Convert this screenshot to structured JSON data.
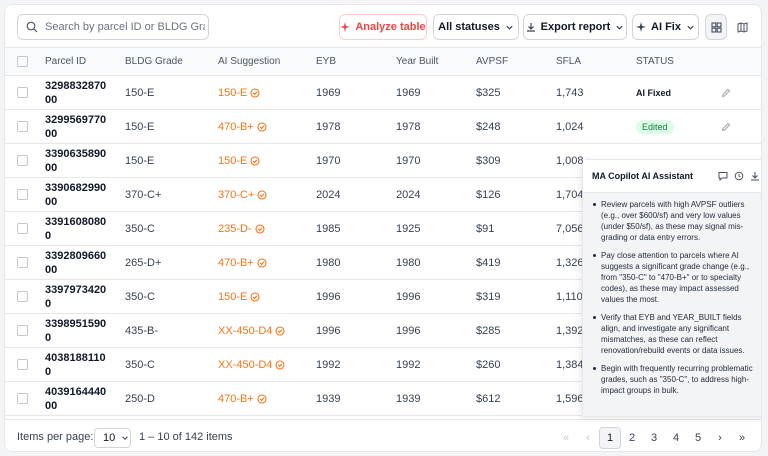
{
  "search": {
    "placeholder": "Search by parcel ID or BLDG Grade",
    "value": ""
  },
  "toolbar": {
    "analyze_label": "Analyze table",
    "status_label": "All statuses",
    "export_label": "Export report",
    "aifix_label": "AI Fix"
  },
  "columns": [
    "Parcel ID",
    "BLDG Grade",
    "AI Suggestion",
    "EYB",
    "Year Built",
    "AVPSF",
    "SFLA",
    "STATUS"
  ],
  "rows": [
    {
      "parcel": "3298832870 00",
      "grade": "150-E",
      "ai": "150-E",
      "eyb": "1969",
      "year": "1969",
      "avpsf": "$325",
      "sfla": "1,743",
      "status": "AI Fixed"
    },
    {
      "parcel": "3299569770 00",
      "grade": "150-E",
      "ai": "470-B+",
      "eyb": "1978",
      "year": "1978",
      "avpsf": "$248",
      "sfla": "1,024",
      "status": "Edited"
    },
    {
      "parcel": "3390635890 00",
      "grade": "150-E",
      "ai": "150-E",
      "eyb": "1970",
      "year": "1970",
      "avpsf": "$309",
      "sfla": "1,008",
      "status": ""
    },
    {
      "parcel": "3390682990 00",
      "grade": "370-C+",
      "ai": "370-C+",
      "eyb": "2024",
      "year": "2024",
      "avpsf": "$126",
      "sfla": "1,704",
      "status": ""
    },
    {
      "parcel": "3391608080 0",
      "grade": "350-C",
      "ai": "235-D-",
      "eyb": "1985",
      "year": "1925",
      "avpsf": "$91",
      "sfla": "7,056",
      "status": ""
    },
    {
      "parcel": "3392809660 00",
      "grade": "265-D+",
      "ai": "470-B+",
      "eyb": "1980",
      "year": "1980",
      "avpsf": "$419",
      "sfla": "1,326",
      "status": ""
    },
    {
      "parcel": "3397973420 0",
      "grade": "350-C",
      "ai": "150-E",
      "eyb": "1996",
      "year": "1996",
      "avpsf": "$319",
      "sfla": "1,110",
      "status": ""
    },
    {
      "parcel": "3398951590 0",
      "grade": "435-B-",
      "ai": "XX-450-D4",
      "eyb": "1996",
      "year": "1996",
      "avpsf": "$285",
      "sfla": "1,392",
      "status": ""
    },
    {
      "parcel": "4038188110 0",
      "grade": "350-C",
      "ai": "XX-450-D4",
      "eyb": "1992",
      "year": "1992",
      "avpsf": "$260",
      "sfla": "1,384",
      "status": ""
    },
    {
      "parcel": "4039164440 00",
      "grade": "250-D",
      "ai": "470-B+",
      "eyb": "1939",
      "year": "1939",
      "avpsf": "$612",
      "sfla": "1,596",
      "status": ""
    }
  ],
  "footer": {
    "items_label": "Items per page:",
    "per_page": "10",
    "range": "1 – 10 of 142 items",
    "pages": [
      "1",
      "2",
      "3",
      "4",
      "5"
    ]
  },
  "assistant": {
    "title": "MA Copilot AI Assistant",
    "tips": [
      "Review parcels with high AVPSF outliers (e.g., over $600/sf) and very low values (under $50/sf), as these may signal mis-grading or data entry errors.",
      "Pay close attention to parcels where AI suggests a significant grade change (e.g., from \"350-C\" to \"470-B+\" or to specialty codes), as these may impact assessed values the most.",
      "Verify that EYB and YEAR_BUILT fields align, and investigate any significant mismatches, as these can reflect renovation/rebuild events or data issues.",
      "Begin with frequently recurring problematic grades, such as \"350-C\", to address high-impact groups in bulk."
    ]
  },
  "colors": {
    "accent": "#f97316",
    "analyze": "#ef4444",
    "edited_bg": "#dcfce7",
    "edited_fg": "#15803d"
  }
}
